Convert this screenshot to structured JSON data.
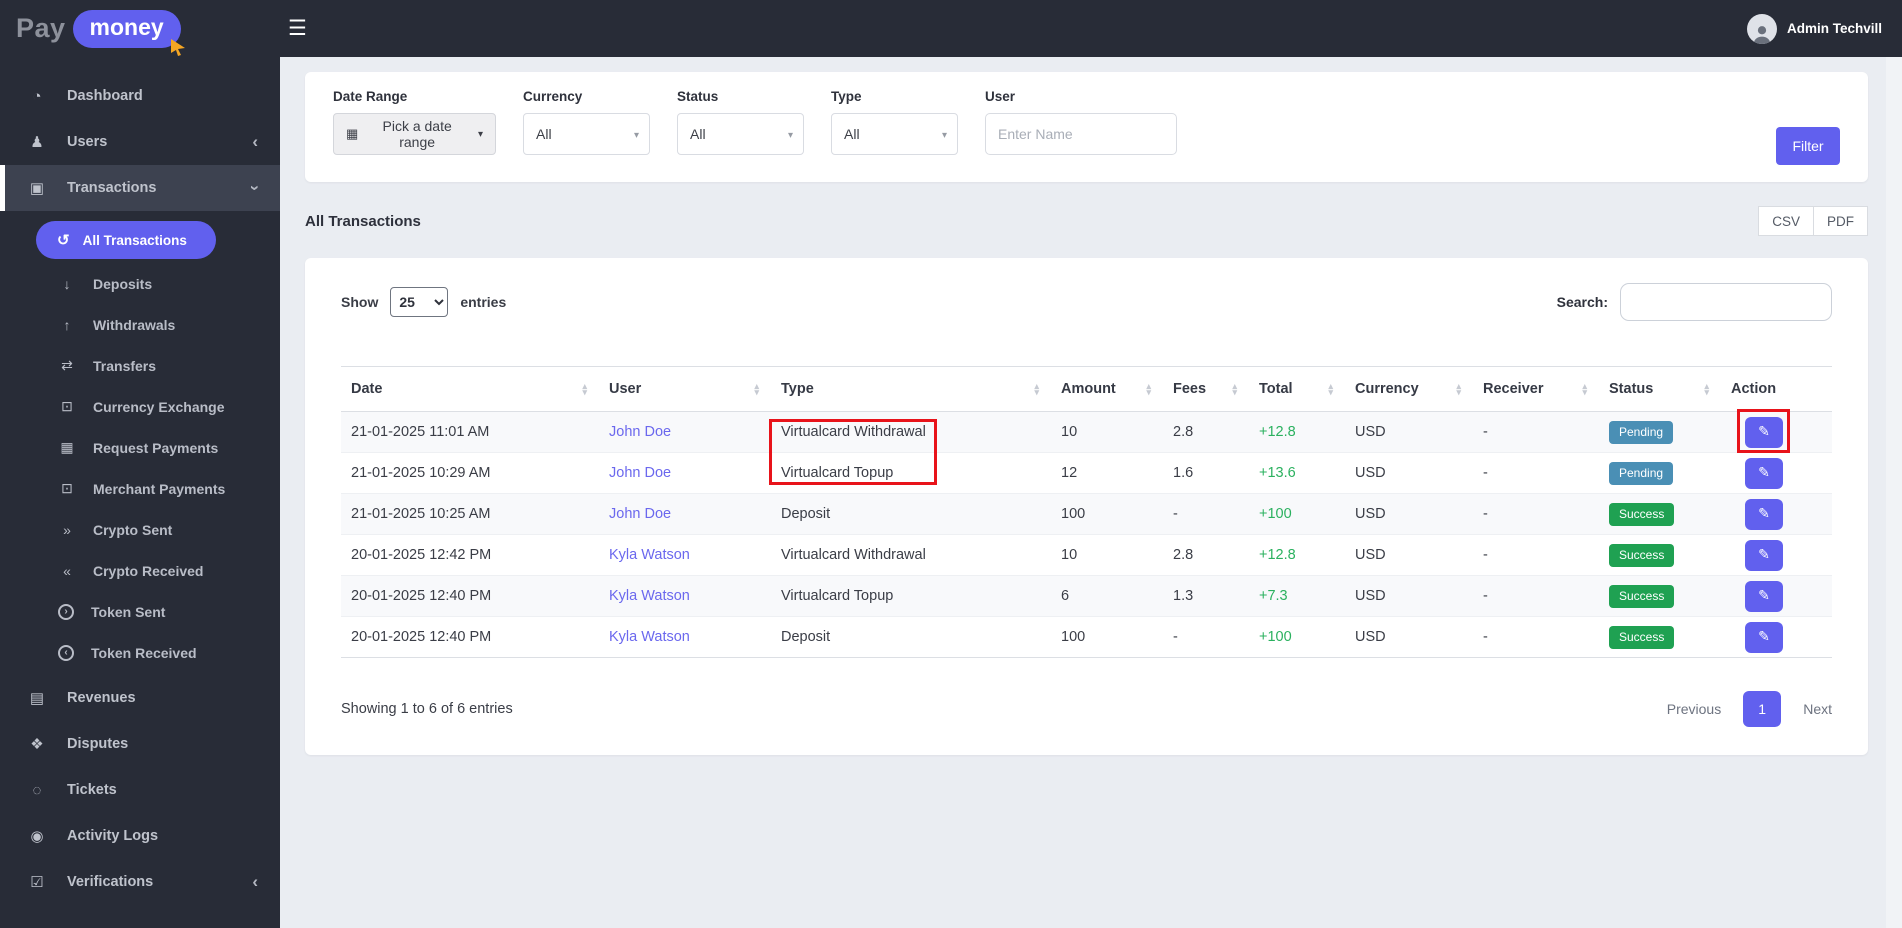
{
  "brand": {
    "pay": "Pay",
    "money": "money"
  },
  "navbar": {
    "admin_name": "Admin Techvill"
  },
  "glyphs": {
    "hamburger": "☰",
    "caret": "▾",
    "sort_up": "▴",
    "sort_down": "▾",
    "chevron_left": "‹",
    "chevron_down": "›",
    "calendar": "▦",
    "edit": "✎"
  },
  "sidebar": {
    "items_top": [
      {
        "label": "Dashboard",
        "glyph": "◔"
      },
      {
        "label": "Users",
        "glyph": "♟",
        "chevron": "‹"
      }
    ],
    "transactions": {
      "label": "Transactions",
      "glyph": "▣",
      "chevron": "›"
    },
    "submenu": [
      {
        "label": "All Transactions",
        "glyph": "↺"
      },
      {
        "label": "Deposits",
        "glyph": "↓"
      },
      {
        "label": "Withdrawals",
        "glyph": "↑"
      },
      {
        "label": "Transfers",
        "glyph": "⇄"
      },
      {
        "label": "Currency Exchange",
        "glyph": "⊡"
      },
      {
        "label": "Request Payments",
        "glyph": "▦"
      },
      {
        "label": "Merchant Payments",
        "glyph": "⊡"
      },
      {
        "label": "Crypto Sent",
        "glyph": "»"
      },
      {
        "label": "Crypto Received",
        "glyph": "«"
      },
      {
        "label": "Token Sent",
        "glyph": "›"
      },
      {
        "label": "Token Received",
        "glyph": "‹"
      }
    ],
    "items_bottom": [
      {
        "label": "Revenues",
        "glyph": "▤"
      },
      {
        "label": "Disputes",
        "glyph": "❖"
      },
      {
        "label": "Tickets",
        "glyph": "◌"
      },
      {
        "label": "Activity Logs",
        "glyph": "◉"
      },
      {
        "label": "Verifications",
        "glyph": "☑",
        "chevron": "‹"
      }
    ]
  },
  "filters": {
    "date_range": {
      "label": "Date Range",
      "value": "Pick a date range"
    },
    "currency": {
      "label": "Currency",
      "value": "All"
    },
    "status": {
      "label": "Status",
      "value": "All"
    },
    "type": {
      "label": "Type",
      "value": "All"
    },
    "user": {
      "label": "User",
      "placeholder": "Enter Name"
    },
    "filter_button": "Filter"
  },
  "section": {
    "title": "All Transactions",
    "csv_button": "CSV",
    "pdf_button": "PDF"
  },
  "controls": {
    "show_label": "Show",
    "page_size": "25",
    "entries_label": "entries",
    "search_label": "Search:"
  },
  "table": {
    "headers": [
      "Date",
      "User",
      "Type",
      "Amount",
      "Fees",
      "Total",
      "Currency",
      "Receiver",
      "Status",
      "Action"
    ],
    "rows": [
      {
        "date": "21-01-2025 11:01 AM",
        "user": "John Doe",
        "type": "Virtualcard Withdrawal",
        "amount": "10",
        "fees": "2.8",
        "total": "+12.8",
        "currency": "USD",
        "receiver": "-",
        "status": "Pending"
      },
      {
        "date": "21-01-2025 10:29 AM",
        "user": "John Doe",
        "type": "Virtualcard Topup",
        "amount": "12",
        "fees": "1.6",
        "total": "+13.6",
        "currency": "USD",
        "receiver": "-",
        "status": "Pending"
      },
      {
        "date": "21-01-2025 10:25 AM",
        "user": "John Doe",
        "type": "Deposit",
        "amount": "100",
        "fees": "-",
        "total": "+100",
        "currency": "USD",
        "receiver": "-",
        "status": "Success"
      },
      {
        "date": "20-01-2025 12:42 PM",
        "user": "Kyla Watson",
        "type": "Virtualcard Withdrawal",
        "amount": "10",
        "fees": "2.8",
        "total": "+12.8",
        "currency": "USD",
        "receiver": "-",
        "status": "Success"
      },
      {
        "date": "20-01-2025 12:40 PM",
        "user": "Kyla Watson",
        "type": "Virtualcard Topup",
        "amount": "6",
        "fees": "1.3",
        "total": "+7.3",
        "currency": "USD",
        "receiver": "-",
        "status": "Success"
      },
      {
        "date": "20-01-2025 12:40 PM",
        "user": "Kyla Watson",
        "type": "Deposit",
        "amount": "100",
        "fees": "-",
        "total": "+100",
        "currency": "USD",
        "receiver": "-",
        "status": "Success"
      }
    ]
  },
  "pagination": {
    "summary": "Showing 1 to 6 of 6 entries",
    "previous": "Previous",
    "page": "1",
    "next": "Next"
  },
  "colors": {
    "accent_purple": "#6160ee",
    "navbar_dark": "#282c37",
    "active_row_dark": "#3d4250",
    "pending_badge": "#4a8fb5",
    "success_badge": "#1fa152",
    "total_green": "#2bb15f",
    "link_purple": "#6b68ee",
    "annotation_red": "#e8131a",
    "page_background": "#eaedf2"
  }
}
